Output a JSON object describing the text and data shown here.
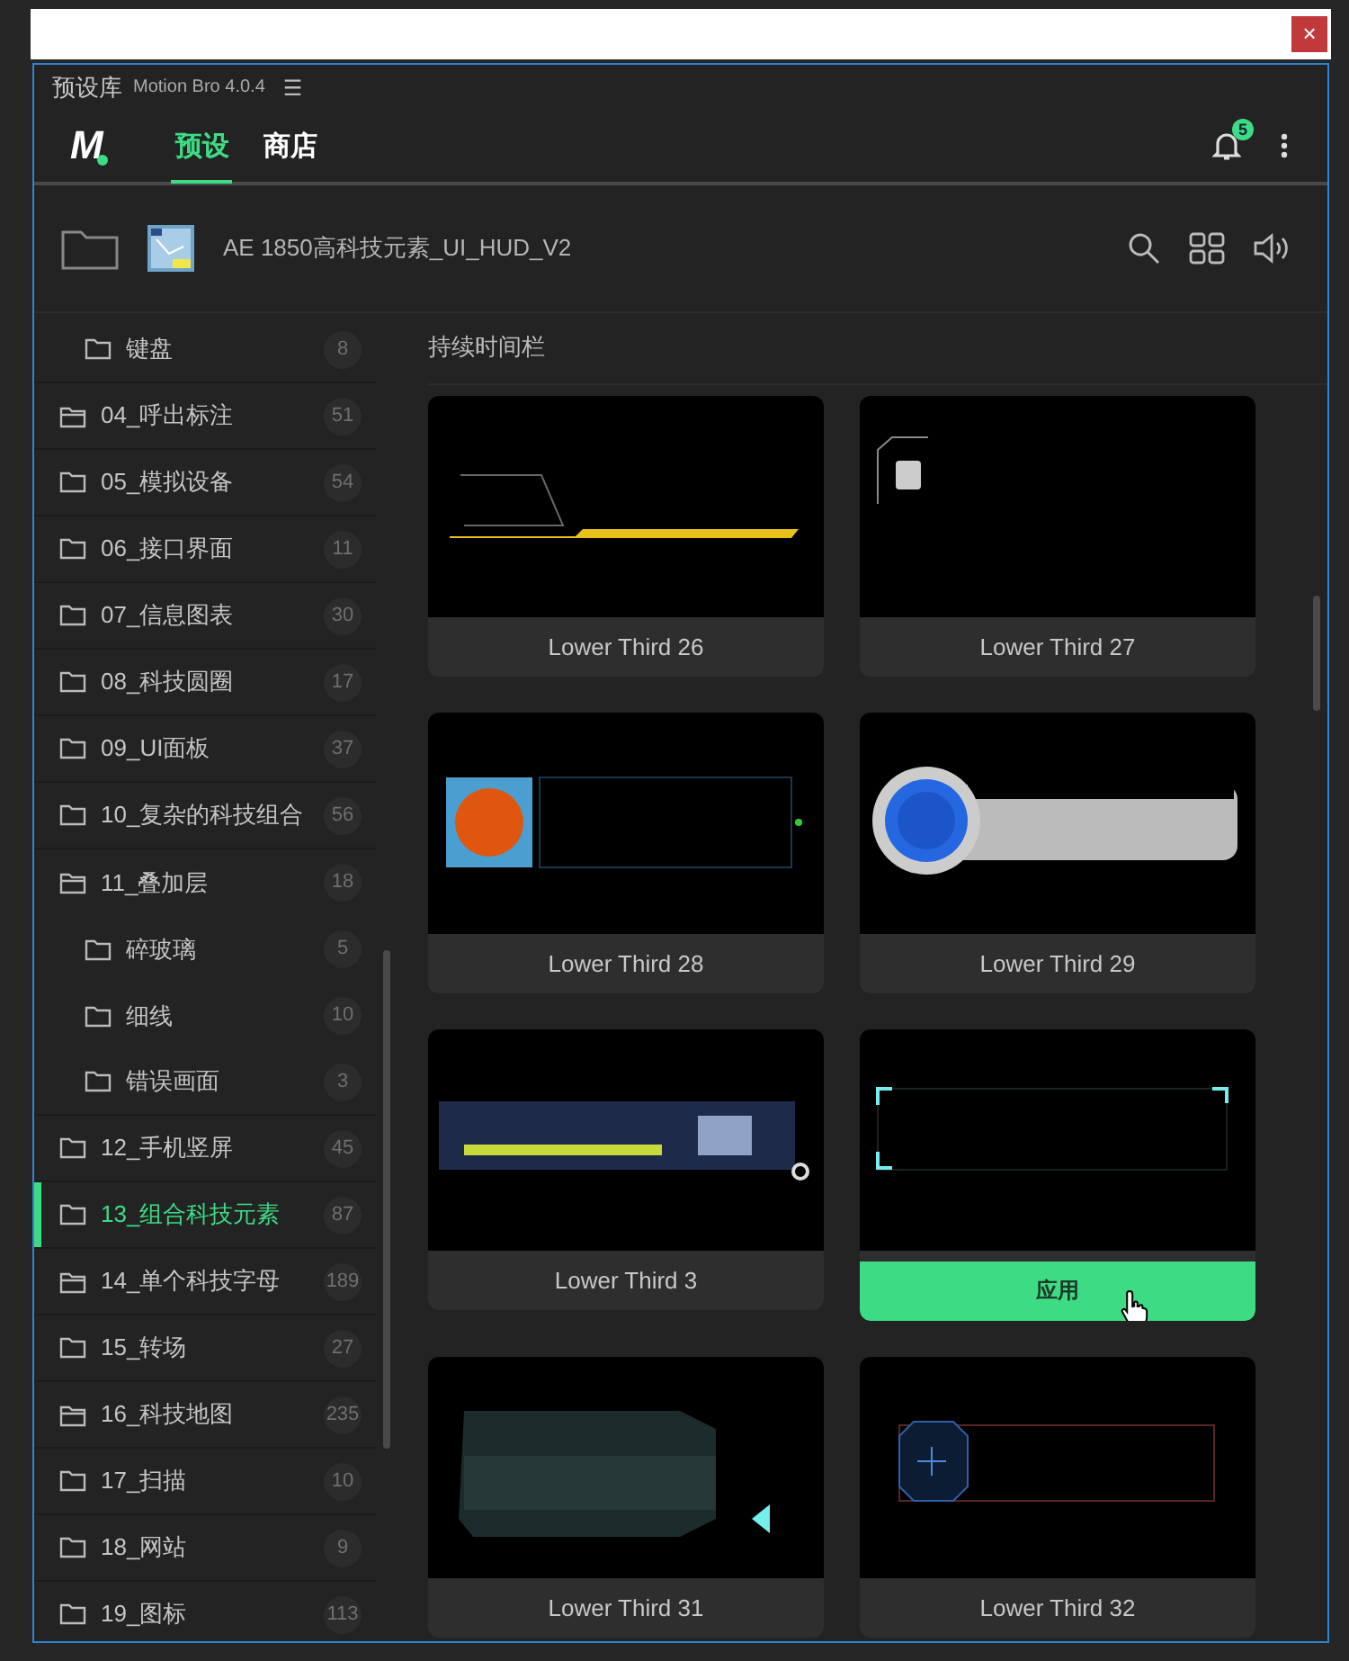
{
  "window": {
    "close": "×"
  },
  "panel": {
    "title": "预设库",
    "version": "Motion Bro 4.0.4",
    "menu": "☰"
  },
  "nav": {
    "logo": "M",
    "tabs": [
      {
        "label": "预设",
        "selected": true
      },
      {
        "label": "商店",
        "selected": false
      }
    ],
    "notifications": "5"
  },
  "pack": {
    "title": "AE 1850高科技元素_UI_HUD_V2"
  },
  "sidebar": {
    "items": [
      {
        "label": "键盘",
        "count": "8",
        "kind": "subfolder",
        "selected": false
      },
      {
        "label": "04_呼出标注",
        "count": "51",
        "kind": "group",
        "selected": false
      },
      {
        "label": "05_模拟设备",
        "count": "54",
        "kind": "folder",
        "selected": false
      },
      {
        "label": "06_接口界面",
        "count": "11",
        "kind": "folder",
        "selected": false
      },
      {
        "label": "07_信息图表",
        "count": "30",
        "kind": "folder",
        "selected": false
      },
      {
        "label": "08_科技圆圈",
        "count": "17",
        "kind": "folder",
        "selected": false
      },
      {
        "label": "09_UI面板",
        "count": "37",
        "kind": "folder",
        "selected": false
      },
      {
        "label": "10_复杂的科技组合",
        "count": "56",
        "kind": "folder",
        "selected": false
      },
      {
        "label": "11_叠加层",
        "count": "18",
        "kind": "group",
        "selected": false,
        "children": [
          {
            "label": "碎玻璃",
            "count": "5",
            "kind": "folder",
            "selected": false
          },
          {
            "label": "细线",
            "count": "10",
            "kind": "folder",
            "selected": false
          },
          {
            "label": "错误画面",
            "count": "3",
            "kind": "folder",
            "selected": false
          }
        ]
      },
      {
        "label": "12_手机竖屏",
        "count": "45",
        "kind": "folder",
        "selected": false
      },
      {
        "label": "13_组合科技元素",
        "count": "87",
        "kind": "folder",
        "selected": true
      },
      {
        "label": "14_单个科技字母",
        "count": "189",
        "kind": "group",
        "selected": false
      },
      {
        "label": "15_转场",
        "count": "27",
        "kind": "folder",
        "selected": false
      },
      {
        "label": "16_科技地图",
        "count": "235",
        "kind": "group",
        "selected": false
      },
      {
        "label": "17_扫描",
        "count": "10",
        "kind": "folder",
        "selected": false
      },
      {
        "label": "18_网站",
        "count": "9",
        "kind": "folder",
        "selected": false
      },
      {
        "label": "19_图标",
        "count": "113",
        "kind": "folder",
        "selected": false
      }
    ]
  },
  "content": {
    "heading": "持续时间栏",
    "cards": [
      {
        "label": "Lower Third 26",
        "hovered": false
      },
      {
        "label": "Lower Third 27",
        "hovered": false
      },
      {
        "label": "Lower Third 28",
        "hovered": false
      },
      {
        "label": "Lower Third 29",
        "hovered": false
      },
      {
        "label": "Lower Third 3",
        "hovered": false
      },
      {
        "action": "应用",
        "hovered": true
      },
      {
        "label": "Lower Third 31",
        "hovered": false
      },
      {
        "label": "Lower Third 32",
        "hovered": false
      }
    ]
  }
}
